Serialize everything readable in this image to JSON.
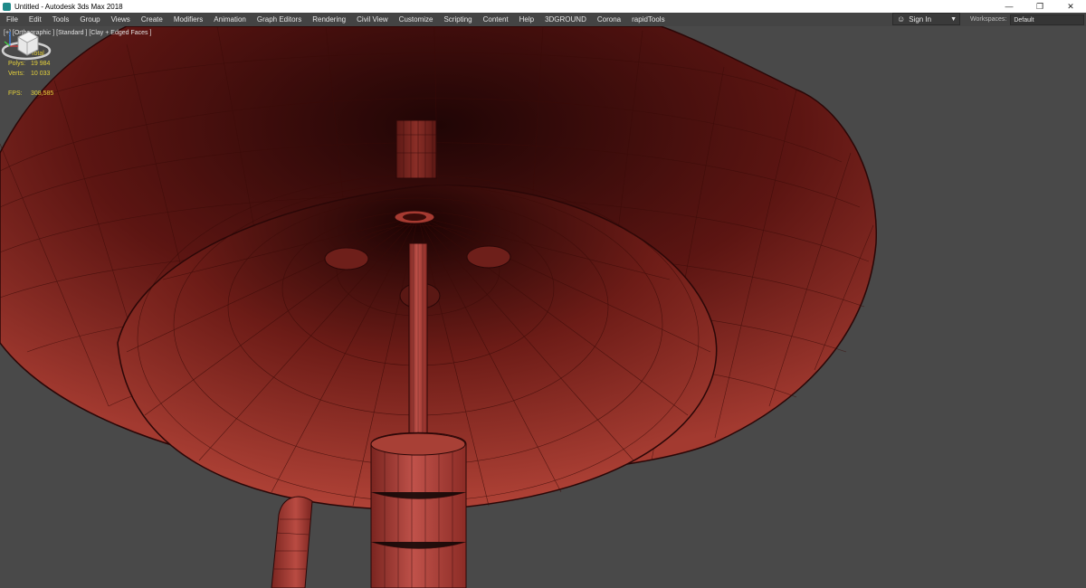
{
  "window": {
    "title": "Untitled - Autodesk 3ds Max 2018",
    "controls": [
      "—",
      "❐",
      "✕"
    ]
  },
  "menu": {
    "items": [
      "File",
      "Edit",
      "Tools",
      "Group",
      "Views",
      "Create",
      "Modifiers",
      "Animation",
      "Graph Editors",
      "Rendering",
      "Civil View",
      "Customize",
      "Scripting",
      "Content",
      "Help",
      "3DGROUND",
      "Corona",
      "rapidTools"
    ]
  },
  "account": {
    "sign_in": "Sign In"
  },
  "workspaces": {
    "label": "Workspaces:",
    "value": "Default"
  },
  "viewport": {
    "label": "[+] [Orthographic ] [Standard ] [Clay + Edged Faces ]",
    "stats": {
      "header": "Total",
      "polys_label": "Polys:",
      "polys": "19 984",
      "verts_label": "Verts:",
      "verts": "10 033",
      "fps_label": "FPS:",
      "fps": "308,585"
    }
  },
  "colors": {
    "viewport_bg": "#494949",
    "clay": "#9a332b",
    "clay_dark": "#2a0707",
    "wire": "#3a0b08",
    "stats": "#e4d03b"
  }
}
